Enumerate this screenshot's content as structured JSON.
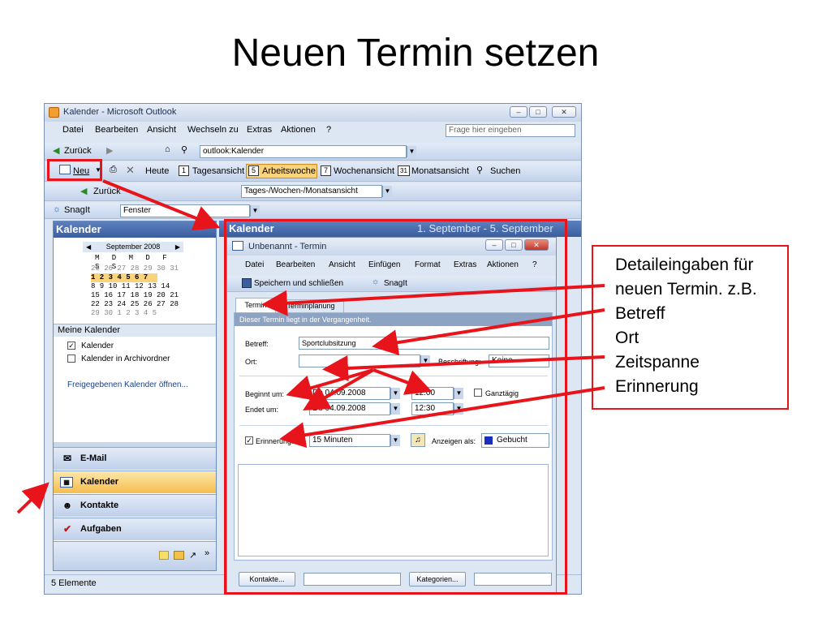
{
  "slide": {
    "title": "Neuen Termin setzen"
  },
  "window": {
    "title": "Kalender - Microsoft Outlook",
    "menu": [
      "Datei",
      "Bearbeiten",
      "Ansicht",
      "Wechseln zu",
      "Extras",
      "Aktionen",
      "?"
    ],
    "help_placeholder": "Frage hier eingeben",
    "nav_bar": {
      "back": "Zurück",
      "address": "outlook:Kalender"
    },
    "toolbar": {
      "new": "Neu",
      "today": "Heute",
      "day_view": "Tagesansicht",
      "workweek_view": "Arbeitswoche",
      "week_view": "Wochenansicht",
      "month_view": "Monatsansicht",
      "search": "Suchen",
      "day_num": "1",
      "workweek_num": "5",
      "week_num": "7",
      "month_num": "31"
    },
    "toolbar2": {
      "back": "Zurück",
      "views_select": "Tages-/Wochen-/Monatsansicht"
    },
    "snagit": {
      "label": "SnagIt",
      "target": "Fenster"
    },
    "status": "5 Elemente",
    "calendar_header": "Kalender",
    "date_range": "1. September - 5. September"
  },
  "nav": {
    "header": "Kalender",
    "month_label": "September 2008",
    "weekdays": "M D M D F S S",
    "weeks": [
      "25 26 27 28 29 30 31",
      " 1  2  3  4  5  6  7",
      " 8  9 10 11 12 13 14",
      "15 16 17 18 19 20 21",
      "22 23 24 25 26 27 28",
      "29 30  1  2  3  4  5"
    ],
    "my_calendars_header": "Meine Kalender",
    "calendars": [
      {
        "label": "Kalender",
        "checked": true
      },
      {
        "label": "Kalender in Archivordner",
        "checked": false
      }
    ],
    "shared_link": "Freigegebenen Kalender öffnen...",
    "buttons": [
      {
        "label": "E-Mail",
        "icon": "mail-icon"
      },
      {
        "label": "Kalender",
        "icon": "calendar-icon"
      },
      {
        "label": "Kontakte",
        "icon": "contacts-icon"
      },
      {
        "label": "Aufgaben",
        "icon": "tasks-icon"
      }
    ]
  },
  "dialog": {
    "title": "Unbenannt - Termin",
    "menu": [
      "Datei",
      "Bearbeiten",
      "Ansicht",
      "Einfügen",
      "Format",
      "Extras",
      "Aktionen",
      "?"
    ],
    "save_close": "Speichern und schließen",
    "snagit": "SnagIt",
    "tabs": [
      "Termin",
      "Terminplanung"
    ],
    "info_bar": "Dieser Termin liegt in der Vergangenheit.",
    "subject_label": "Betreff:",
    "subject_value": "Sportclubsitzung",
    "location_label": "Ort:",
    "location_value": "",
    "label_label": "Beschriftung:",
    "label_value": "Keine",
    "start_label": "Beginnt um:",
    "start_date": "Do 04.09.2008",
    "start_time": "12:00",
    "allday_label": "Ganztägig",
    "end_label": "Endet um:",
    "end_date": "Do 04.09.2008",
    "end_time": "12:30",
    "reminder_label": "Erinnerung:",
    "reminder_value": "15 Minuten",
    "show_as_label": "Anzeigen als:",
    "show_as_value": "Gebucht",
    "contacts_button": "Kontakte...",
    "categories_button": "Kategorien..."
  },
  "callout": {
    "lines": [
      "Detaileingaben für",
      "neuen Termin. z.B.",
      "Betreff",
      "Ort",
      "Zeitspanne",
      "Erinnerung"
    ]
  },
  "colors": {
    "highlight_red": "#e8141b",
    "outlook_blue": "#3b5e9e",
    "active_orange": "#f6bd4e"
  }
}
